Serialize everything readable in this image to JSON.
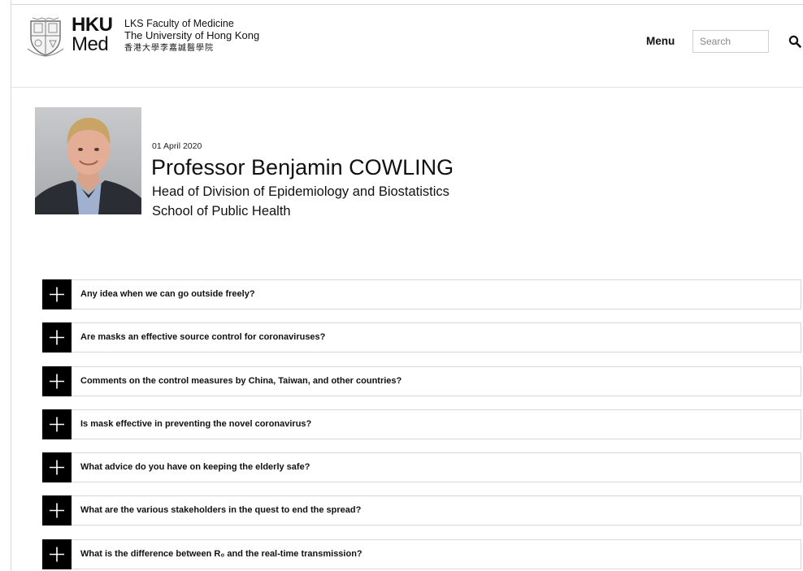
{
  "header": {
    "logo_hku": "HKU",
    "logo_med": "Med",
    "faculty_line1": "LKS Faculty of Medicine",
    "faculty_line2": "The University of Hong Kong",
    "faculty_line3": "香港大學李嘉誠醫學院",
    "menu_label": "Menu",
    "search_placeholder": "Search"
  },
  "profile": {
    "date": "01 April 2020",
    "name": "Professor Benjamin COWLING",
    "title_line1": "Head of Division of Epidemiology and Biostatistics",
    "title_line2": "School of Public Health"
  },
  "faq": [
    {
      "question": "Any idea when we can go outside freely?"
    },
    {
      "question": "Are masks an effective source control for coronaviruses?"
    },
    {
      "question": "Comments on the control measures by China, Taiwan, and other countries?"
    },
    {
      "question": "Is mask effective in preventing the novel coronavirus?"
    },
    {
      "question": "What advice do you have on keeping the elderly safe?"
    },
    {
      "question": "What are the various stakeholders in the quest to end the spread?"
    },
    {
      "question": "What is the difference between R₀ and the real-time transmission?"
    }
  ],
  "icons": {
    "crest": "hku-crest-icon",
    "search": "search-icon",
    "expand": "plus-icon"
  },
  "colors": {
    "toggle_background": "#000000",
    "border": "#d7d7d7",
    "text": "#111111"
  }
}
